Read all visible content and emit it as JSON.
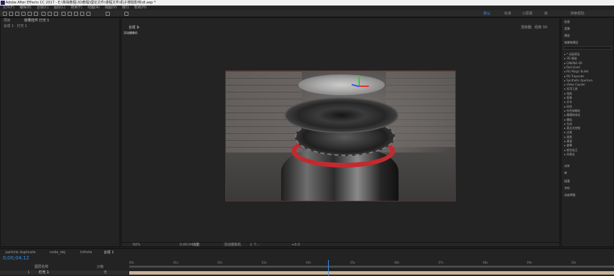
{
  "window": {
    "title": "Adobe After Effects CC 2017 - E:\\简易教程\\3D教程\\理论文件\\课程文件\\机子搜取影响\\dl.aep *"
  },
  "menu": [
    "文件(F)",
    "编辑(E)",
    "合成(C)",
    "图层(L)",
    "效果(T)",
    "动画(A)",
    "视图(V)",
    "窗口",
    "帮助(H)"
  ],
  "workspaces": [
    "默认",
    "标准",
    "小屏幕",
    "库"
  ],
  "workspace_active": "默认",
  "search_help_placeholder": "搜索帮助",
  "left_panel": {
    "tab_project": "项目",
    "tab_effect": "效果控件 灯光 1",
    "subtitle": "合成 1 · 灯光 1"
  },
  "viewer": {
    "tab": "合成 1",
    "tab_close": "≡",
    "label": "活动摄像机",
    "renderer_label": "渲染器:",
    "renderer_value": "经典 3D",
    "footer": {
      "zoom": "50%",
      "timecode": "0;00;04;12",
      "res": "完整",
      "camera": "活动摄像机",
      "views": "1 个...",
      "offset": "+0.0"
    }
  },
  "right_panel": {
    "sections": [
      "信息",
      "音频",
      "预览",
      "效果和预设"
    ],
    "search": "",
    "effects": [
      "* 动画预设",
      "3D 通道",
      "CINEMA 4D",
      "Red Giant",
      "RG Magic Bullet",
      "RG Trapcode",
      "Synthetic Aperture",
      "Video Copilot",
      "实用工具",
      "扭曲",
      "抠像",
      "文本",
      "时间",
      "杂色和颗粒",
      "模糊和锐化",
      "模拟",
      "生成",
      "表达式控制",
      "过渡",
      "透视",
      "通道",
      "遮罩",
      "颜色校正",
      "风格化"
    ],
    "lower": [
      "对齐",
      "库",
      "段落",
      "字符",
      "动态草图"
    ]
  },
  "timeline": {
    "tabs": [
      "particle duplicate",
      "node_obj",
      "Infinite",
      "合成 1"
    ],
    "active_tab": "合成 1",
    "timecode": "0;00;04;12",
    "columns": [
      "图层名称",
      "父级"
    ],
    "layer": {
      "num": "1",
      "name": "灯光 1",
      "parent": "无"
    },
    "ruler": [
      "00s",
      "01s",
      "02s",
      "03s",
      "04s",
      "05s",
      "06s",
      "07s",
      "08s",
      "09s",
      "10s"
    ]
  },
  "colors": {
    "accent": "#3a8fe8",
    "red_ring": "#c32a2f",
    "gizmo_x": "#e03030",
    "gizmo_y": "#32c832",
    "gizmo_z": "#2f55e8"
  }
}
